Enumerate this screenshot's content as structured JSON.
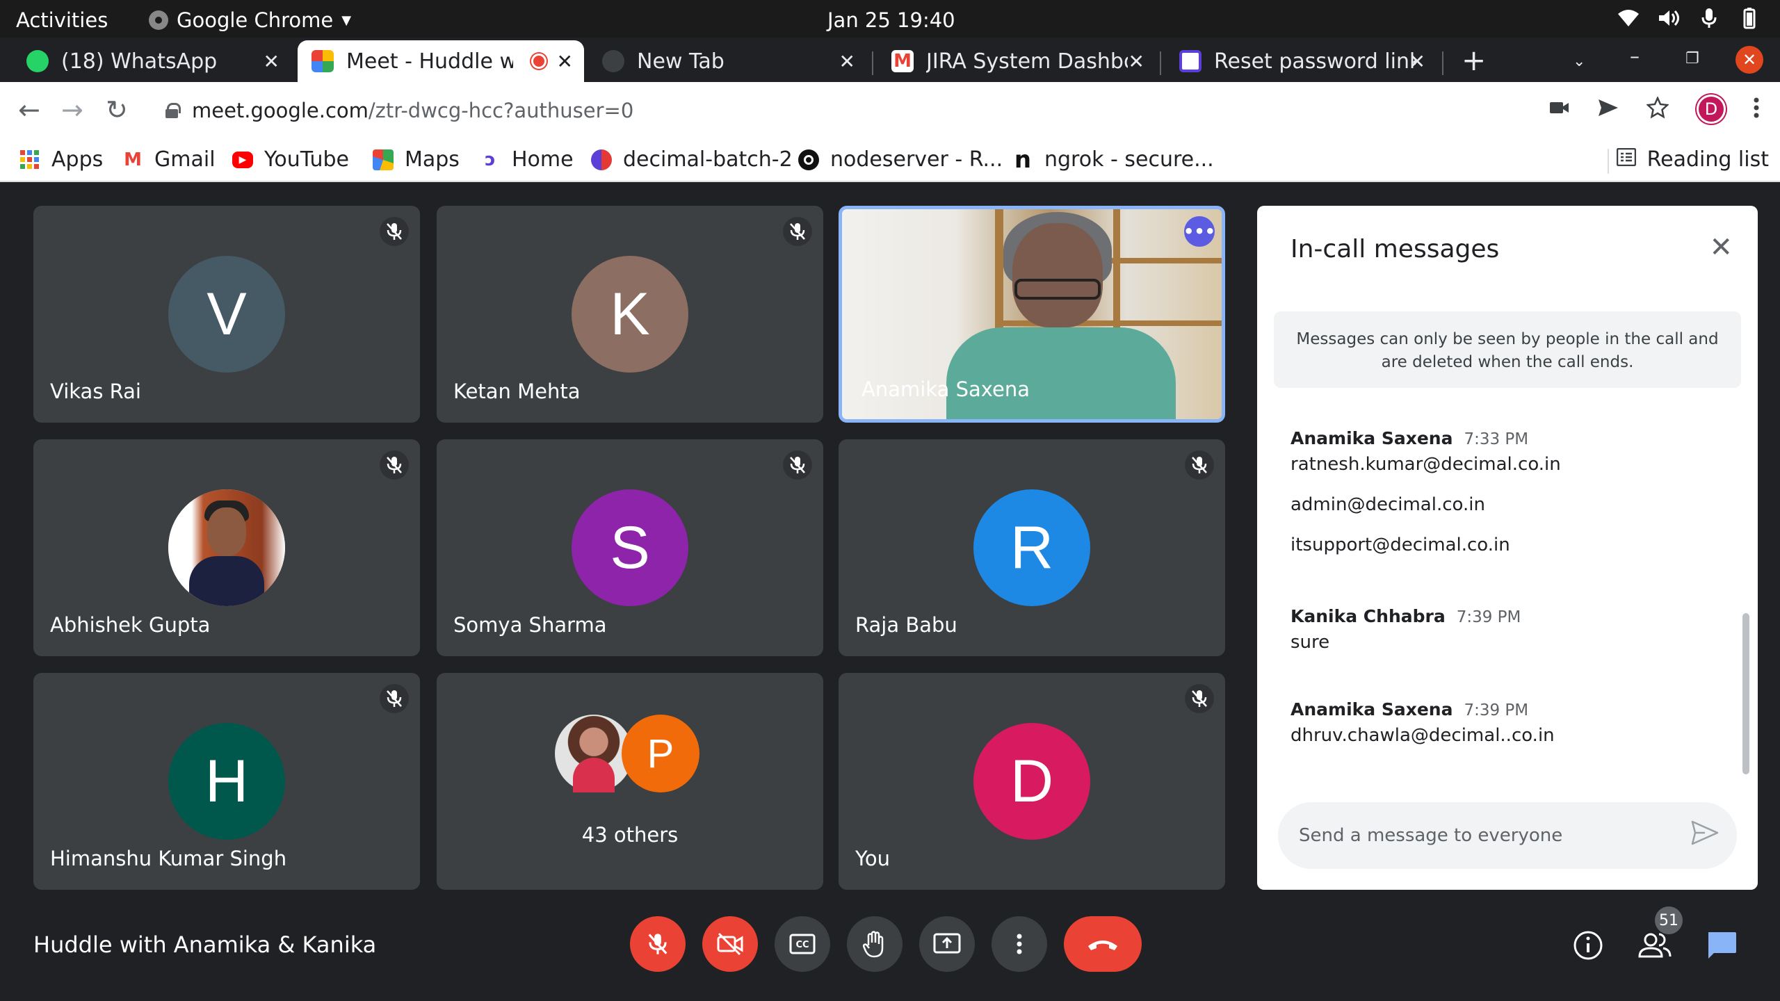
{
  "os": {
    "activities": "Activities",
    "app_name": "Google Chrome",
    "clock": "Jan 25  19:40"
  },
  "tabs": [
    {
      "label": "(18) WhatsApp",
      "icon": "whatsapp-icon"
    },
    {
      "label": "Meet - Huddle wi",
      "icon": "meet-icon",
      "recording": true
    },
    {
      "label": "New Tab",
      "icon": "chrome-icon"
    },
    {
      "label": "JIRA System Dashbo",
      "icon": "gmail-icon"
    },
    {
      "label": "Reset password link",
      "icon": "decimal-icon"
    }
  ],
  "address": {
    "host": "meet.google.com",
    "path": "/ztr-dwcg-hcc?authuser=0"
  },
  "profile_initial": "D",
  "bookmarks": [
    {
      "label": "Apps"
    },
    {
      "label": "Gmail"
    },
    {
      "label": "YouTube"
    },
    {
      "label": "Maps"
    },
    {
      "label": "Home"
    },
    {
      "label": "decimal-batch-2"
    },
    {
      "label": "nodeserver - R..."
    },
    {
      "label": "ngrok - secure..."
    }
  ],
  "reading_list": "Reading list",
  "participants": [
    {
      "name": "Vikas Rai",
      "initial": "V",
      "color": "#455a64"
    },
    {
      "name": "Ketan Mehta",
      "initial": "K",
      "color": "#8d6e63"
    },
    {
      "name": "Anamika Saxena"
    },
    {
      "name": "Abhishek Gupta"
    },
    {
      "name": "Somya Sharma",
      "initial": "S",
      "color": "#8e24aa"
    },
    {
      "name": "Raja Babu",
      "initial": "R",
      "color": "#1e88e5"
    },
    {
      "name": "Himanshu Kumar Singh",
      "initial": "H",
      "color": "#00574b"
    },
    {
      "name": "You",
      "initial": "D",
      "color": "#d81b60"
    }
  ],
  "others": {
    "label": "43 others",
    "initial": "P"
  },
  "chat": {
    "title": "In-call messages",
    "notice": "Messages can only be seen by people in the call and are deleted when the call ends.",
    "messages": [
      {
        "sender": "Anamika Saxena",
        "time": "7:33 PM",
        "lines": [
          "ratnesh.kumar@decimal.co.in",
          "admin@decimal.co.in",
          "itsupport@decimal.co.in"
        ]
      },
      {
        "sender": "Kanika Chhabra",
        "time": "7:39 PM",
        "lines": [
          "sure"
        ]
      },
      {
        "sender": "Anamika Saxena",
        "time": "7:39 PM",
        "lines": [
          "dhruv.chawla@decimal..co.in"
        ]
      }
    ],
    "input_placeholder": "Send a message to everyone"
  },
  "meeting_title": "Huddle with Anamika & Kanika",
  "people_count": "51"
}
